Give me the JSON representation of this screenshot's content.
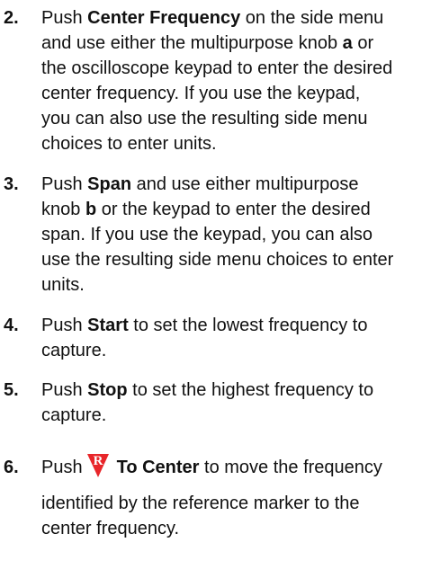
{
  "steps": [
    {
      "number": "2.",
      "lines": [
        {
          "t1": "Push ",
          "b1": "Center Frequency",
          "t2": " on the side menu"
        },
        {
          "t1": "and use either the multipurpose knob ",
          "b1": "a",
          "t2": " or"
        },
        {
          "t1": "the oscilloscope keypad to enter the desired"
        },
        {
          "t1": "center frequency.  If you use the keypad,"
        },
        {
          "t1": "you can also use the resulting side menu"
        },
        {
          "t1": "choices to enter units."
        }
      ]
    },
    {
      "number": "3.",
      "lines": [
        {
          "t1": "Push ",
          "b1": "Span",
          "t2": " and use either multipurpose"
        },
        {
          "t1": "knob ",
          "b1": "b",
          "t2": " or the keypad to enter the desired"
        },
        {
          "t1": "span.  If you use the keypad, you can also"
        },
        {
          "t1": "use the resulting side menu choices to enter"
        },
        {
          "t1": "units."
        }
      ]
    },
    {
      "number": "4.",
      "lines": [
        {
          "t1": "Push ",
          "b1": "Start",
          "t2": " to set the lowest frequency to"
        },
        {
          "t1": "capture."
        }
      ]
    },
    {
      "number": "5.",
      "lines": [
        {
          "t1": "Push ",
          "b1": "Stop",
          "t2": " to set the highest frequency to"
        },
        {
          "t1": "capture."
        }
      ]
    },
    {
      "number": "6.",
      "lines": [
        {
          "t1": "Push",
          "b1": "To Center",
          "t2": " to move the frequency"
        },
        {
          "t1": "identified by the reference marker to the"
        },
        {
          "t1": "center frequency."
        }
      ]
    }
  ],
  "marker_icon": {
    "letter": "R",
    "color": "#e8262a",
    "letter_color": "#ffffff"
  }
}
